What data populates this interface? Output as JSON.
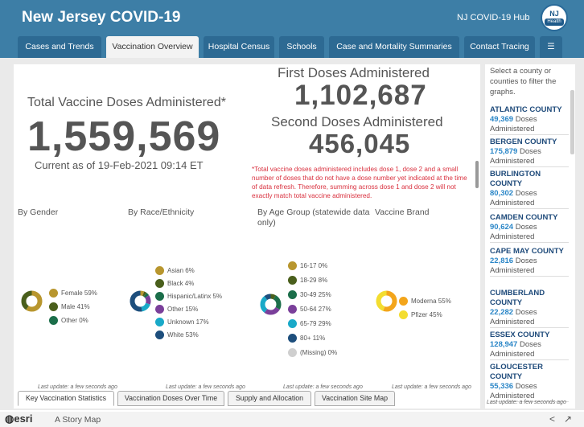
{
  "header": {
    "title": "New Jersey COVID-19",
    "hub_link": "NJ COVID-19 Hub",
    "logo_text": "NJ",
    "logo_sub": "Health"
  },
  "tabs": [
    {
      "label": "Cases and Trends"
    },
    {
      "label": "Vaccination Overview",
      "active": true
    },
    {
      "label": "Hospital Census"
    },
    {
      "label": "Schools"
    },
    {
      "label": "Case and Mortality Summaries"
    },
    {
      "label": "Contact Tracing"
    },
    {
      "label": "☰",
      "icon": "list-icon"
    }
  ],
  "stats": {
    "total_label": "Total Vaccine Doses Administered*",
    "total_value": "1,559,569",
    "as_of": "Current as of 19-Feb-2021 09:14 ET",
    "first_label": "First Doses Administered",
    "first_value": "1,102,687",
    "second_label": "Second Doses Administered",
    "second_value": "456,045",
    "note": "*Total vaccine doses administered includes dose 1, dose 2 and a small number of doses that do not have a dose number yet indicated at the time of data refresh. Therefore, summing across dose 1 and dose 2 will not exactly match total vaccine administered."
  },
  "sections": {
    "gender": "By Gender",
    "race": "By Race/Ethnicity",
    "age": "By Age Group (statewide data only)",
    "brand": "Vaccine Brand"
  },
  "last_update": "Last update: a few seconds ago",
  "bottom_tabs": [
    {
      "label": "Key Vaccination Statistics",
      "active": true
    },
    {
      "label": "Vaccination Doses Over Time"
    },
    {
      "label": "Supply and Allocation"
    },
    {
      "label": "Vaccination Site Map"
    }
  ],
  "sidebar": {
    "intro": "Select a county or counties to filter the graphs.",
    "doses_word": "Doses Administered",
    "counties": [
      {
        "name": "ATLANTIC COUNTY",
        "value": "49,369"
      },
      {
        "name": "BERGEN COUNTY",
        "value": "175,879"
      },
      {
        "name": "BURLINGTON COUNTY",
        "value": "80,302"
      },
      {
        "name": "CAMDEN COUNTY",
        "value": "90,624"
      },
      {
        "name": "CAPE MAY COUNTY",
        "value": "22,816"
      },
      {
        "name": "CUMBERLAND COUNTY",
        "value": "22,282"
      },
      {
        "name": "ESSEX COUNTY",
        "value": "128,947"
      },
      {
        "name": "GLOUCESTER COUNTY",
        "value": "55,336"
      }
    ],
    "last_update": "Last update: a few seconds ago"
  },
  "footer": {
    "brand": "esri",
    "tagline": "A Story Map",
    "share_icon": "share-icon",
    "external_icon": "external-link-icon"
  },
  "chart_data": [
    {
      "type": "pie",
      "title": "By Gender",
      "categories": [
        "Female",
        "Male",
        "Other"
      ],
      "values": [
        59,
        41,
        0
      ],
      "labels": [
        "Female 59%",
        "Male 41%",
        "Other 0%"
      ],
      "colors": [
        "#b8962e",
        "#4a5f1c",
        "#1b6e4a"
      ]
    },
    {
      "type": "pie",
      "title": "By Race/Ethnicity",
      "categories": [
        "Asian",
        "Black",
        "Hispanic/Latinx",
        "Other",
        "Unknown",
        "White"
      ],
      "values": [
        6,
        4,
        5,
        15,
        17,
        53
      ],
      "labels": [
        "Asian 6%",
        "Black 4%",
        "Hispanic/Latinx 5%",
        "Other 15%",
        "Unknown 17%",
        "White 53%"
      ],
      "colors": [
        "#b8962e",
        "#4a5f1c",
        "#1b6e4a",
        "#7a3f9a",
        "#19a9c8",
        "#1d4e7c"
      ]
    },
    {
      "type": "pie",
      "title": "By Age Group (statewide data only)",
      "categories": [
        "16-17",
        "18-29",
        "30-49",
        "50-64",
        "65-79",
        "80+",
        "(Missing)"
      ],
      "values": [
        0,
        8,
        25,
        27,
        29,
        11,
        0
      ],
      "labels": [
        "16-17 0%",
        "18-29 8%",
        "30-49 25%",
        "50-64 27%",
        "65-79 29%",
        "80+ 11%",
        "(Missing) 0%"
      ],
      "colors": [
        "#b8962e",
        "#4a5f1c",
        "#1b6e4a",
        "#7a3f9a",
        "#19a9c8",
        "#1d4e7c",
        "#cfcfcf"
      ]
    },
    {
      "type": "pie",
      "title": "Vaccine Brand",
      "categories": [
        "Moderna",
        "Pfizer"
      ],
      "values": [
        55,
        45
      ],
      "labels": [
        "Moderna 55%",
        "Pfizer 45%"
      ],
      "colors": [
        "#f3a51b",
        "#f3dd30"
      ]
    }
  ]
}
